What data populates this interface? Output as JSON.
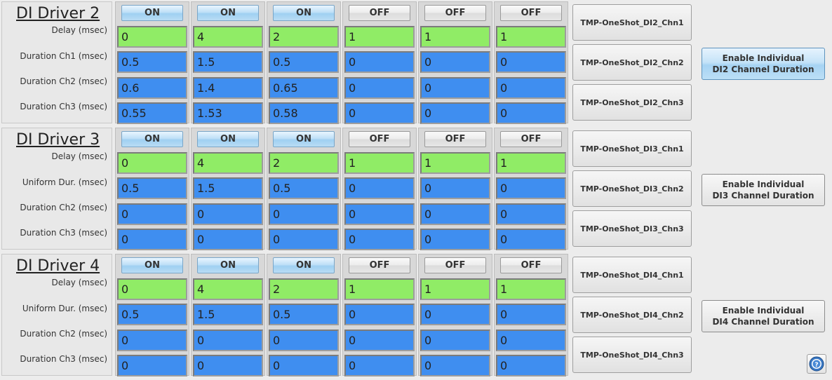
{
  "drivers": [
    {
      "title": "DI Driver 2",
      "row_labels": [
        "Delay  (msec)",
        "Duration Ch1 (msec)",
        "Duration Ch2 (msec)",
        "Duration Ch3 (msec)"
      ],
      "toggles": [
        "ON",
        "ON",
        "ON",
        "OFF",
        "OFF",
        "OFF"
      ],
      "delay": [
        "0",
        "4",
        "2",
        "1",
        "1",
        "1"
      ],
      "row2": [
        "0.5",
        "1.5",
        "0.5",
        "0",
        "0",
        "0"
      ],
      "row3": [
        "0.6",
        "1.4",
        "0.65",
        "0",
        "0",
        "0"
      ],
      "row4": [
        "0.55",
        "1.53",
        "0.58",
        "0",
        "0",
        "0"
      ],
      "tmp_buttons": [
        "TMP-OneShot_DI2_Chn1",
        "TMP-OneShot_DI2_Chn2",
        "TMP-OneShot_DI2_Chn3"
      ],
      "enable_line1": "Enable Individual",
      "enable_line2": "DI2 Channel Duration"
    },
    {
      "title": "DI Driver 3",
      "row_labels": [
        "Delay  (msec)",
        "Uniform Dur. (msec)",
        "Duration Ch2 (msec)",
        "Duration Ch3 (msec)"
      ],
      "toggles": [
        "ON",
        "ON",
        "ON",
        "OFF",
        "OFF",
        "OFF"
      ],
      "delay": [
        "0",
        "4",
        "2",
        "1",
        "1",
        "1"
      ],
      "row2": [
        "0.5",
        "1.5",
        "0.5",
        "0",
        "0",
        "0"
      ],
      "row3": [
        "0",
        "0",
        "0",
        "0",
        "0",
        "0"
      ],
      "row4": [
        "0",
        "0",
        "0",
        "0",
        "0",
        "0"
      ],
      "tmp_buttons": [
        "TMP-OneShot_DI3_Chn1",
        "TMP-OneShot_DI3_Chn2",
        "TMP-OneShot_DI3_Chn3"
      ],
      "enable_line1": "Enable Individual",
      "enable_line2": "DI3 Channel Duration"
    },
    {
      "title": "DI Driver 4",
      "row_labels": [
        "Delay  (msec)",
        "Uniform Dur. (msec)",
        "Duration Ch2 (msec)",
        "Duration Ch3 (msec)"
      ],
      "toggles": [
        "ON",
        "ON",
        "ON",
        "OFF",
        "OFF",
        "OFF"
      ],
      "delay": [
        "0",
        "4",
        "2",
        "1",
        "1",
        "1"
      ],
      "row2": [
        "0.5",
        "1.5",
        "0.5",
        "0",
        "0",
        "0"
      ],
      "row3": [
        "0",
        "0",
        "0",
        "0",
        "0",
        "0"
      ],
      "row4": [
        "0",
        "0",
        "0",
        "0",
        "0",
        "0"
      ],
      "tmp_buttons": [
        "TMP-OneShot_DI4_Chn1",
        "TMP-OneShot_DI4_Chn2",
        "TMP-OneShot_DI4_Chn3"
      ],
      "enable_line1": "Enable Individual",
      "enable_line2": "DI4 Channel Duration"
    }
  ],
  "colors": {
    "delay_field": "#90ec66",
    "duration_field": "#3f8ef0",
    "toggle_on": "#9fd0f2",
    "enable_active": "#a6d3f3"
  },
  "enable_active_index": 0,
  "help_icon": "question-mark-icon"
}
